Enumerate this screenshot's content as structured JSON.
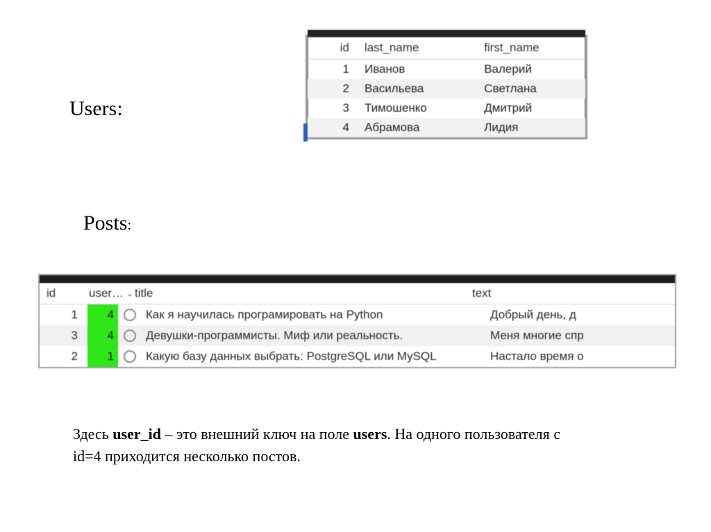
{
  "labels": {
    "users": "Users:",
    "posts": "Posts",
    "posts_colon": ":"
  },
  "users_table": {
    "headers": {
      "id": "id",
      "last_name": "last_name",
      "first_name": "first_name"
    },
    "rows": [
      {
        "id": "1",
        "last_name": "Иванов",
        "first_name": "Валерий"
      },
      {
        "id": "2",
        "last_name": "Васильева",
        "first_name": "Светлана"
      },
      {
        "id": "3",
        "last_name": "Тимошенко",
        "first_name": "Дмитрий"
      },
      {
        "id": "4",
        "last_name": "Абрамова",
        "first_name": "Лидия"
      }
    ]
  },
  "posts_table": {
    "headers": {
      "id": "id",
      "user": "user…",
      "title": "title",
      "text": "text"
    },
    "rows": [
      {
        "id": "1",
        "user_id": "4",
        "title": "Как я научилась програмировать на Python",
        "text": "Добрый день, д"
      },
      {
        "id": "3",
        "user_id": "4",
        "title": "Девушки-программисты. Миф или реальность.",
        "text": "Меня многие спр"
      },
      {
        "id": "2",
        "user_id": "1",
        "title": "Какую базу данных выбрать: PostgreSQL или MySQL",
        "text": "Настало время о"
      }
    ]
  },
  "caption": {
    "p1a": "Здесь ",
    "b1": "user_id",
    "p1b": " – это внешний ключ на поле ",
    "b2": "users",
    "p1c": ". На одного пользователя с",
    "p2": "id=4 приходится несколько постов."
  }
}
